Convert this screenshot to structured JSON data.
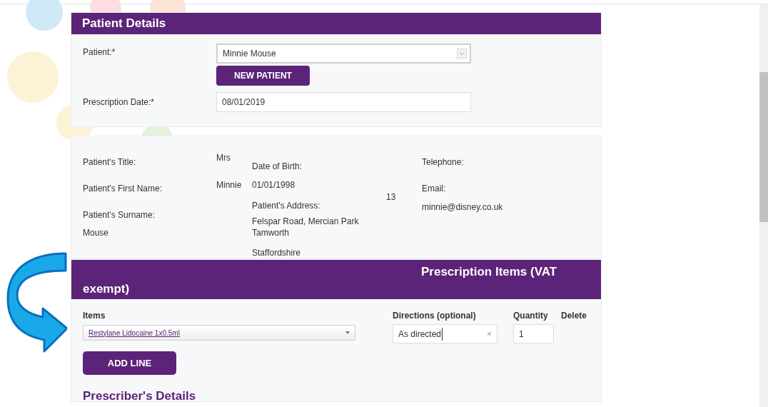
{
  "patient_details": {
    "title": "Patient Details",
    "patient_label": "Patient:*",
    "patient_value": "Minnie Mouse",
    "new_patient_button": "NEW PATIENT",
    "date_label": "Prescription Date:*",
    "date_value": "08/01/2019"
  },
  "details": {
    "title_label": "Patient's Title:",
    "title": "Mrs",
    "first_name_label": "Patient's First Name:",
    "first_name": "Minnie",
    "surname_label": "Patient's Surname:",
    "surname": "Mouse",
    "dob_label": "Date of Birth:",
    "dob": "01/01/1998",
    "address_label": "Patient's Address:",
    "address_number": "13",
    "address_lines": [
      "Felspar Road, Mercian Park",
      "Tamworth"
    ],
    "address_county": "Staffordshire",
    "telephone_label": "Telephone:",
    "email_label": "Email:",
    "email": "minnie@disney.co.uk"
  },
  "prescription_items": {
    "title": "Prescription Items (VAT exempt)",
    "items_label": "Items",
    "item_value": "Restylane Lidocaine 1x0.5ml",
    "directions_label": "Directions (optional)",
    "directions_value": "As directed",
    "clear_symbol": "×",
    "quantity_label": "Quantity",
    "quantity_value": "1",
    "delete_label": "Delete",
    "add_line_button": "ADD LINE"
  },
  "prescriber_title": "Prescriber's Details"
}
